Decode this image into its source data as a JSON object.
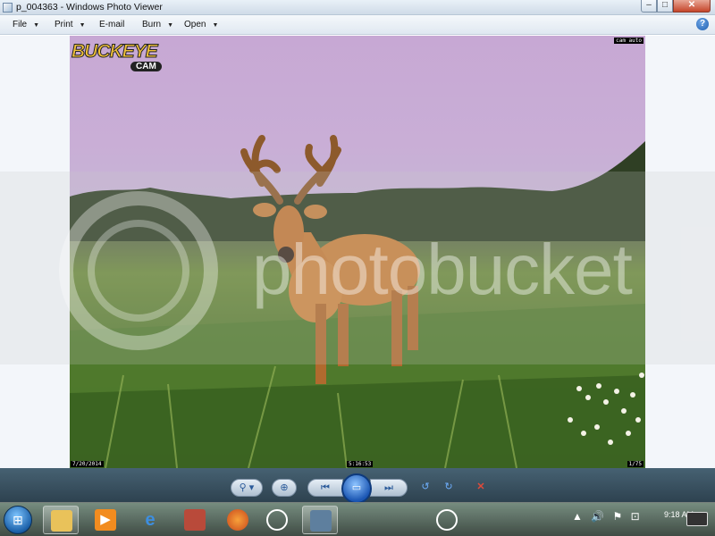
{
  "window": {
    "title": "p_004363 - Windows Photo Viewer",
    "controls": {
      "minimize": "–",
      "maximize": "□",
      "close": "✕"
    }
  },
  "menu": [
    {
      "label": "File",
      "has_dropdown": true
    },
    {
      "label": "Print",
      "has_dropdown": true
    },
    {
      "label": "E-mail",
      "has_dropdown": false
    },
    {
      "label": "Burn",
      "has_dropdown": true
    },
    {
      "label": "Open",
      "has_dropdown": true
    }
  ],
  "help_label": "?",
  "photo": {
    "logo_top": "BUCKEYE",
    "logo_bottom": "CAM",
    "stamp_top_right": "cam auto",
    "stamp_bottom_left": "7/20/2014",
    "stamp_bottom_center": "5:16:53",
    "stamp_bottom_right": "1/75"
  },
  "watermark": {
    "text": "photobucket"
  },
  "viewer_controls": {
    "zoom": "⚲ ▾",
    "fit": "⊕",
    "previous": "⏮",
    "slideshow": "▭",
    "next": "⏭",
    "rotate_ccw": "↺",
    "rotate_cw": "↻",
    "delete": "✕"
  },
  "taskbar": {
    "start_icon": "⊞",
    "clock": "9:18 AM"
  }
}
